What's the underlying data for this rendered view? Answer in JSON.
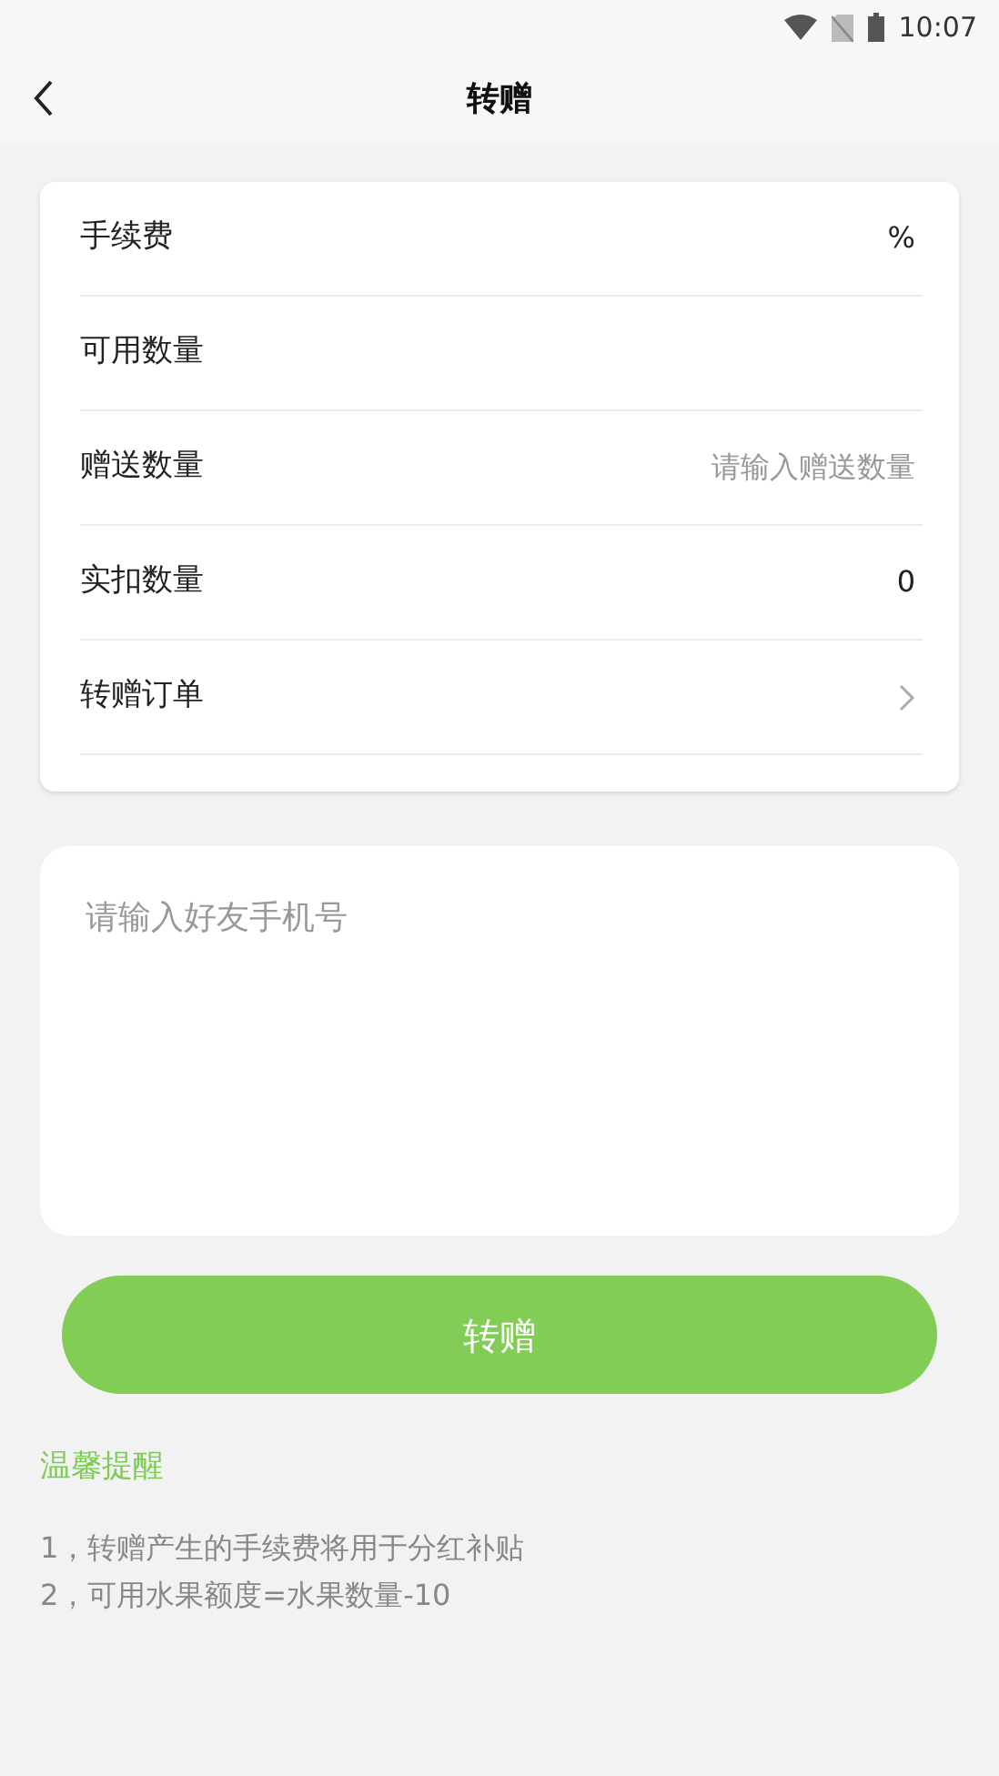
{
  "status_bar": {
    "time": "10:07"
  },
  "header": {
    "title": "转赠"
  },
  "rows": [
    {
      "kind": "value",
      "label": "手续费",
      "value": "%"
    },
    {
      "kind": "value",
      "label": "可用数量"
    },
    {
      "kind": "input",
      "label": "赠送数量",
      "placeholder": "请输入赠送数量"
    },
    {
      "kind": "value",
      "label": "实扣数量",
      "value": "0"
    },
    {
      "kind": "link",
      "label": "转赠订单"
    }
  ],
  "phone_field": {
    "placeholder": "请输入好友手机号"
  },
  "submit_button": "转赠",
  "tips": {
    "title": "温馨提醒",
    "lines": [
      "1，转赠产生的手续费将用于分红补贴",
      "2，可用水果额度=水果数量-10"
    ]
  }
}
